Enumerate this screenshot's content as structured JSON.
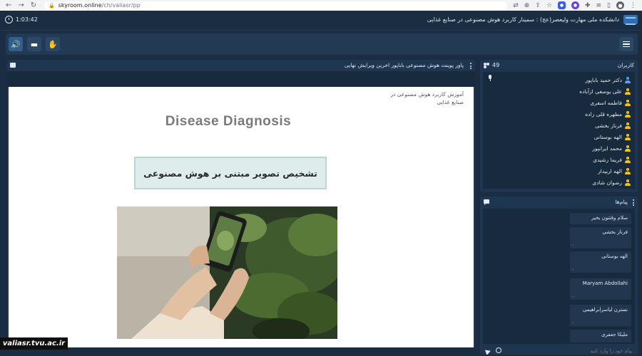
{
  "browser": {
    "url_host": "skyroom.online",
    "url_path": "/ch/valiasr/pp"
  },
  "header": {
    "timer": "1:03:42",
    "room_title": "دانشکده ملی مهارت ولیعصر(عج) : سمینار کاربرد هوش مصنوعی در صنایع غذایی"
  },
  "presentation": {
    "title": "پاور پوینت هوش مصنوعی باباپور اخرین ویرایش نهایی",
    "slide": {
      "subtitle": "آموزش کاربرد هوش مصنوعی در صنایع غذایی",
      "heading": "Disease Diagnosis",
      "box_text": "تشخیص تصویر مبتنی بر هوش مصنوعی"
    }
  },
  "users": {
    "label": "کاربران",
    "count": "49",
    "list": [
      {
        "name": "دکتر حمید باباپور",
        "role": "host"
      },
      {
        "name": "علی یوسفی ازآباده",
        "role": "user"
      },
      {
        "name": "فاطمه اسفری",
        "role": "user"
      },
      {
        "name": "مطهره قلی زاده",
        "role": "user"
      },
      {
        "name": "فرناز بخشی",
        "role": "user"
      },
      {
        "name": "الهه بوستانی",
        "role": "user"
      },
      {
        "name": "محمد ایرانپور",
        "role": "user"
      },
      {
        "name": "فریما رشیدی",
        "role": "user"
      },
      {
        "name": "الهه اربیدار",
        "role": "user"
      },
      {
        "name": "رضوان شادی",
        "role": "user"
      }
    ]
  },
  "messages": {
    "label": "پیام‌ها",
    "items": [
      {
        "name": "سلام وقتتون بخیر",
        "text": ""
      },
      {
        "name": "فرناز بخشی",
        "text": "."
      },
      {
        "name": "الهه بوستانی",
        "text": "."
      },
      {
        "name": "Maryam Abdollahi",
        "text": "."
      },
      {
        "name": "نسترن لیاسرابراهیمی",
        "text": "."
      },
      {
        "name": "ملیکا جعفری",
        "text": ""
      }
    ],
    "input_placeholder": "پیام خود را وارد کنید"
  },
  "watermark": "valiasr.tvu.ac.ir",
  "icons": {
    "speaker": "speaker-icon",
    "folder": "folder-icon",
    "hand": "raise-hand-icon",
    "menu": "hamburger-menu-icon"
  },
  "colors": {
    "app_bg": "#1a2d42",
    "panel_bg": "#1f3650",
    "user_icon": "#f5c400",
    "host_icon": "#4da3ff"
  }
}
